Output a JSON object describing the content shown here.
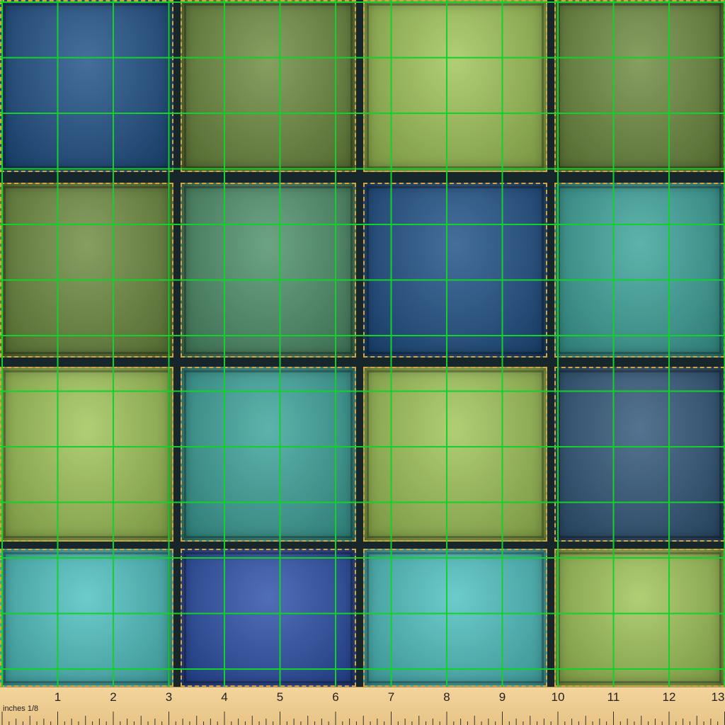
{
  "image": {
    "description_kind": "fabric-swatch",
    "colors": {
      "navy": "#1d4f86",
      "olive": "#6c8a3e",
      "lime": "#9fc456",
      "teal": "#3aa39a",
      "aqua": "#4cc1c0",
      "royal": "#2a4ea8",
      "moss": "#4d8f6a",
      "slate": "#2f5578",
      "seam_dark": "#17262a",
      "stitch": "#d9a23a",
      "grid_green": "#12d22a",
      "ruler_bg": "#efcf93"
    },
    "patch_rows": [
      [
        "navy",
        "olive",
        "lime",
        "olive"
      ],
      [
        "olive",
        "moss",
        "navy",
        "teal"
      ],
      [
        "lime",
        "teal",
        "lime",
        "slate"
      ],
      [
        "aqua",
        "royal",
        "aqua",
        "lime"
      ]
    ]
  },
  "ruler": {
    "unit_label": "inches 1/8",
    "numbers": [
      "1",
      "2",
      "3",
      "4",
      "5",
      "6",
      "7",
      "8",
      "9",
      "10",
      "11",
      "12",
      "13"
    ]
  }
}
